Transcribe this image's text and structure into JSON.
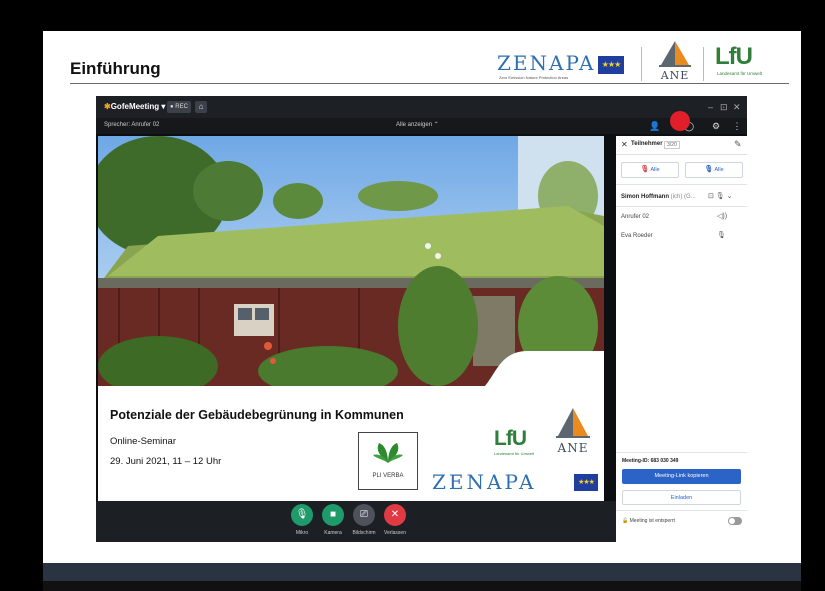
{
  "slide": {
    "title": "Einführung",
    "header_logos": {
      "zenapa_word": "ZENAPA",
      "zenapa_sub": "Zero Emission Nature Protection Areas",
      "ane_word": "ANE",
      "lfu_word": "LfU",
      "lfu_sub": "Landesamt für Umwelt",
      "eu_stars": "★★★"
    }
  },
  "app": {
    "name_prefix": "Gofe",
    "name_suffix": "Meeting ▾",
    "rec_label": "● REC",
    "home_glyph": "⌂",
    "window_controls": [
      "–",
      "⊡",
      "✕"
    ],
    "speaker_label": "Sprecher: Anrufer 02",
    "view_select": "Alle anzeigen ⌃",
    "controls": [
      {
        "label": "Mikro",
        "glyph": "🎙",
        "color": "#1f9a6a"
      },
      {
        "label": "Kamera",
        "glyph": "■",
        "color": "#1f9a6a"
      },
      {
        "label": "Bildschirm",
        "glyph": "⎚",
        "color": "#4d525c"
      },
      {
        "label": "Verlassen",
        "glyph": "✕",
        "color": "#e03a45"
      }
    ]
  },
  "shared_slide": {
    "title": "Potenziale der Gebäudebegrünung in Kommunen",
    "subtitle": "Online-Seminar",
    "date": "29. Juni 2021, 11 – 12 Uhr",
    "pli_label": "PLI VERBA",
    "lfu_word": "LfU",
    "lfu_sub": "Landesamt für Umwelt",
    "ane_word": "ANE",
    "zenapa_word": "ZENAPA",
    "eu_stars": "★★★"
  },
  "panel": {
    "title": "Teilnehmer",
    "count": "3/20",
    "mute_all_button": "Alle",
    "unmute_all_button": "Alle",
    "host_name": "Simon Hoffmann",
    "host_role": "(ich) (G...",
    "host_icons": "⊡ 🎙 ⌄",
    "participants": [
      {
        "name": "Anrufer 02",
        "icon": "◁))"
      },
      {
        "name": "Eva Roeder",
        "icon": "🎙"
      }
    ],
    "meeting_id_label": "Meeting-ID: 683 030 349",
    "copy_link_button": "Meeting-Link kopieren",
    "invite_button": "Einladen",
    "lock_label": "Meeting ist entsperrt"
  },
  "colors": {
    "accent_blue": "#2b63c7",
    "record_red": "#e11f2a",
    "zenapa_blue": "#2d6fb0",
    "lfu_green": "#2f7f3a"
  }
}
